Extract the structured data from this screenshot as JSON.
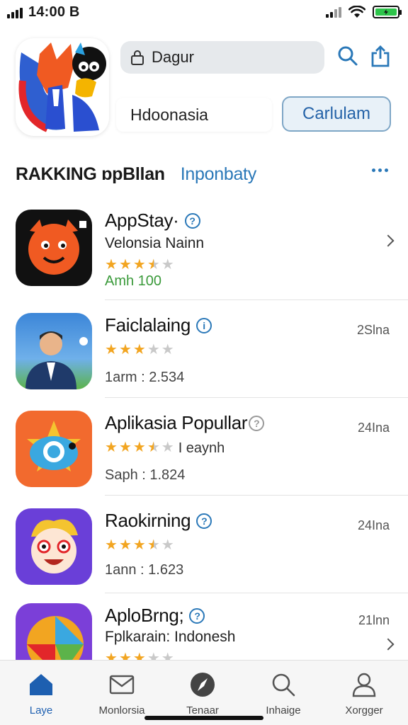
{
  "status": {
    "time": "14:00 B"
  },
  "header": {
    "search_value": "Dagur",
    "region_value": "Hdoonasia",
    "cta_label": "Carlulam",
    "icons": [
      "search-icon",
      "share-icon"
    ]
  },
  "section": {
    "title": "RAKKING ɒpBllan",
    "tab": "Inponbaty",
    "more": "more-icon"
  },
  "apps": [
    {
      "name": "AppStay·",
      "subtitle": "Velonsia Nainn",
      "rating": 3.5,
      "meta": "Amh 100",
      "right": "",
      "colors": [
        "#111111",
        "#f05a22"
      ]
    },
    {
      "name": "Faiclalaing",
      "subtitle": "",
      "rating": 3,
      "meta": "1arm : 2.534",
      "right": "2Slna",
      "colors": [
        "#3c86d8",
        "#5cb34a"
      ]
    },
    {
      "name": "Aplikasia Popullar",
      "subtitle": "",
      "rating": 3.5,
      "stars_extra": "I eaynh",
      "meta": "Saph : 1.824",
      "right": "24Ina",
      "colors": [
        "#f26a2e",
        "#3aa8e0"
      ]
    },
    {
      "name": "Raokirning",
      "subtitle": "",
      "rating": 3.5,
      "meta": "1ann : 1.623",
      "right": "24Ina",
      "colors": [
        "#6a3fd8",
        "#f4c430"
      ]
    },
    {
      "name": "AploBrng;",
      "subtitle": "Fplkarain: Indonesh",
      "rating": 3,
      "meta": "",
      "right": "21lnn",
      "colors": [
        "#7b3fd8",
        "#f2a521"
      ]
    }
  ],
  "tabs": [
    {
      "label": "Laye",
      "icon": "home-icon",
      "active": true
    },
    {
      "label": "Monlorsia",
      "icon": "mail-icon",
      "active": false
    },
    {
      "label": "Tenaar",
      "icon": "compass-icon",
      "active": false
    },
    {
      "label": "Inhaige",
      "icon": "search-icon",
      "active": false
    },
    {
      "label": "Xorgger",
      "icon": "profile-icon",
      "active": false
    }
  ],
  "accent_color": "#2a78b8"
}
